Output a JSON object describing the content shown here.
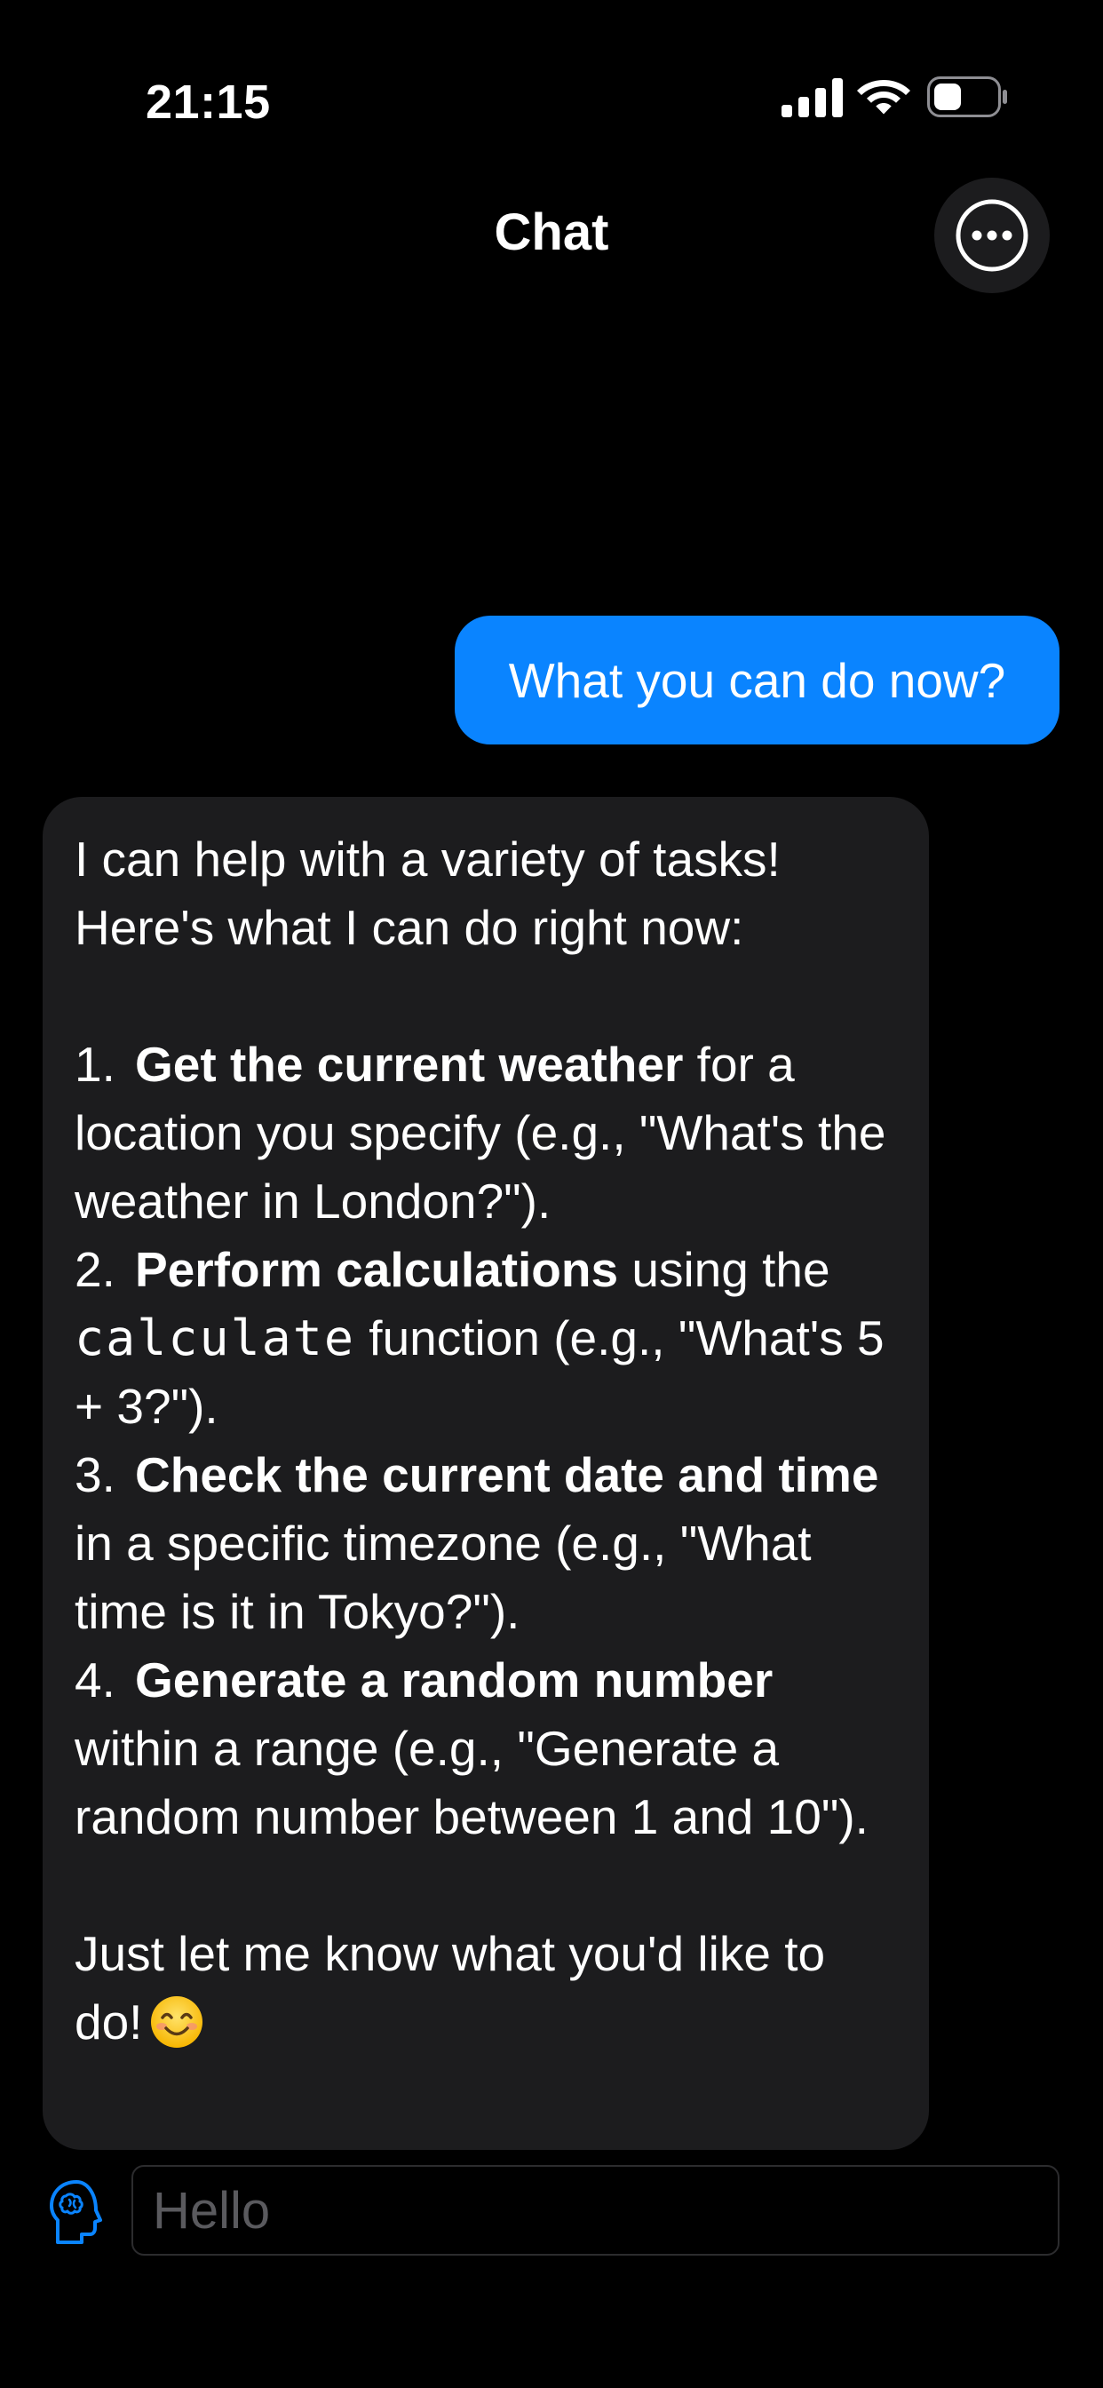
{
  "status_bar": {
    "time": "21:15"
  },
  "header": {
    "title": "Chat",
    "menu_icon": "ellipsis-circle-icon"
  },
  "messages": {
    "user": {
      "text": "What you can do now?"
    },
    "assistant": {
      "line1": "I can help with a variety of tasks!",
      "line2": "Here's what I can do right now:",
      "items": [
        {
          "number": "1.",
          "bold": "Get the current weather",
          "rest": " for a location you specify (e.g., \"What's the weather in London?\")."
        },
        {
          "number": "2.",
          "bold": "Perform calculations",
          "rest_a": " using the ",
          "code": "calculate",
          "rest_b": " function (e.g., \"What's 5 + 3?\")."
        },
        {
          "number": "3.",
          "bold": "Check the current date and time",
          "rest": " in a specific timezone (e.g., \"What time is it in Tokyo?\")."
        },
        {
          "number": "4.",
          "bold": "Generate a random number",
          "rest": " within a range (e.g., \"Generate a random number between 1 and 10\")."
        }
      ],
      "closing": "Just let me know what you'd like to do!",
      "emoji_icon": "smiling-face-emoji-icon"
    }
  },
  "composer": {
    "placeholder": "Hello",
    "value": "",
    "avatar_icon": "brain-head-icon"
  },
  "colors": {
    "background": "#000000",
    "user_bubble": "#0a84ff",
    "assistant_bubble": "#1c1c1e",
    "accent": "#0a84ff"
  }
}
